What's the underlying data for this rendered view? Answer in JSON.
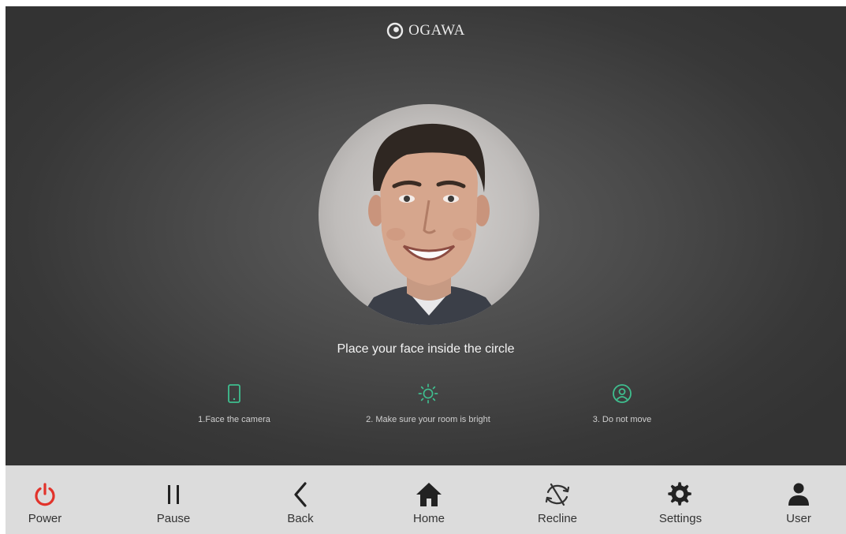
{
  "brand": {
    "name": "OGAWA"
  },
  "main": {
    "prompt": "Place your face inside the circle",
    "tips": [
      {
        "icon": "phone-icon",
        "label": "1.Face the camera"
      },
      {
        "icon": "sun-icon",
        "label": "2. Make sure your room is bright"
      },
      {
        "icon": "person-circle-icon",
        "label": "3. Do not move"
      }
    ]
  },
  "nav": {
    "items": [
      {
        "icon": "power-icon",
        "label": "Power"
      },
      {
        "icon": "pause-icon",
        "label": "Pause"
      },
      {
        "icon": "back-chevron-icon",
        "label": "Back"
      },
      {
        "icon": "home-icon",
        "label": "Home"
      },
      {
        "icon": "recline-icon",
        "label": "Recline"
      },
      {
        "icon": "gear-icon",
        "label": "Settings"
      },
      {
        "icon": "user-icon",
        "label": "User"
      }
    ]
  },
  "colors": {
    "accent_green": "#3fbf8f",
    "power_red": "#e2332b",
    "nav_bg": "#dcdcdc",
    "screen_bg": "#454545"
  }
}
